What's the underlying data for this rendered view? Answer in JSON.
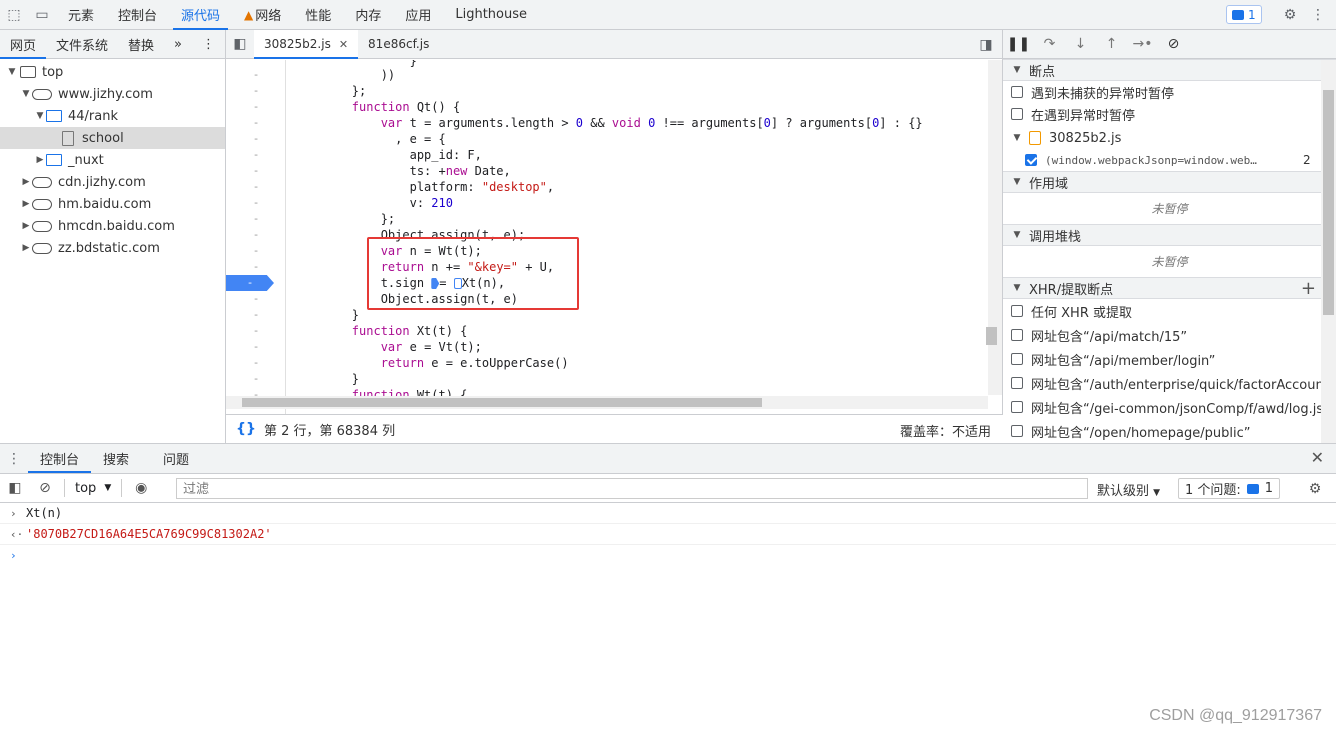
{
  "topbar": {
    "tabs": [
      {
        "label": "元素"
      },
      {
        "label": "控制台"
      },
      {
        "label": "源代码",
        "active": true
      },
      {
        "label": "网络",
        "warning": true
      },
      {
        "label": "性能"
      },
      {
        "label": "内存"
      },
      {
        "label": "应用"
      },
      {
        "label": "Lighthouse"
      }
    ],
    "issue_count": "1"
  },
  "navigator": {
    "tabs": [
      "网页",
      "文件系统",
      "替换"
    ],
    "more": "»",
    "tree": [
      {
        "label": "top",
        "icon": "frame"
      },
      {
        "label": "www.jizhy.com",
        "icon": "cloud"
      },
      {
        "label": "44/rank",
        "icon": "folder"
      },
      {
        "label": "school",
        "icon": "file"
      },
      {
        "label": "_nuxt",
        "icon": "folder"
      },
      {
        "label": "cdn.jizhy.com",
        "icon": "cloud"
      },
      {
        "label": "hm.baidu.com",
        "icon": "cloud"
      },
      {
        "label": "hmcdn.baidu.com",
        "icon": "cloud"
      },
      {
        "label": "zz.bdstatic.com",
        "icon": "cloud"
      }
    ]
  },
  "editor": {
    "tabs": [
      {
        "label": "30825b2.js",
        "active": true,
        "closable": true
      },
      {
        "label": "81e86cf.js"
      }
    ],
    "gutter_mark": "-",
    "status": {
      "position": "第 2 行，第 68384 列",
      "coverage": "覆盖率：不适用"
    }
  },
  "debugger": {
    "sections": {
      "breakpoints": "断点",
      "scope": "作用域",
      "callstack": "调用堆栈",
      "xhr": "XHR/提取断点"
    },
    "pause_uncaught": "遇到未捕获的异常时暂停",
    "pause_caught": "在遇到异常时暂停",
    "bp_file": "30825b2.js",
    "bp_code": "(window.webpackJsonp=window.web…",
    "bp_line": "2",
    "not_paused": "未暂停",
    "xhr_items": [
      "任何 XHR 或提取",
      "网址包含“/api/match/15”",
      "网址包含“/api/member/login”",
      "网址包含“/auth/enterprise/quick/factorAccountL…",
      "网址包含“/gei-common/jsonComp/f/awd/log.js…",
      "网址包含“/open/homepage/public”"
    ]
  },
  "drawer": {
    "tabs": [
      "控制台",
      "搜索",
      "问题"
    ],
    "context": "top",
    "filter_placeholder": "过滤",
    "level": "默认级别",
    "issues_label": "1 个问题:",
    "issues_count": "1"
  },
  "console": {
    "input": "Xt(n)",
    "result": "'8070B27CD16A64E5CA769C99C81302A2'"
  },
  "watermark": "CSDN @qq_912917367"
}
